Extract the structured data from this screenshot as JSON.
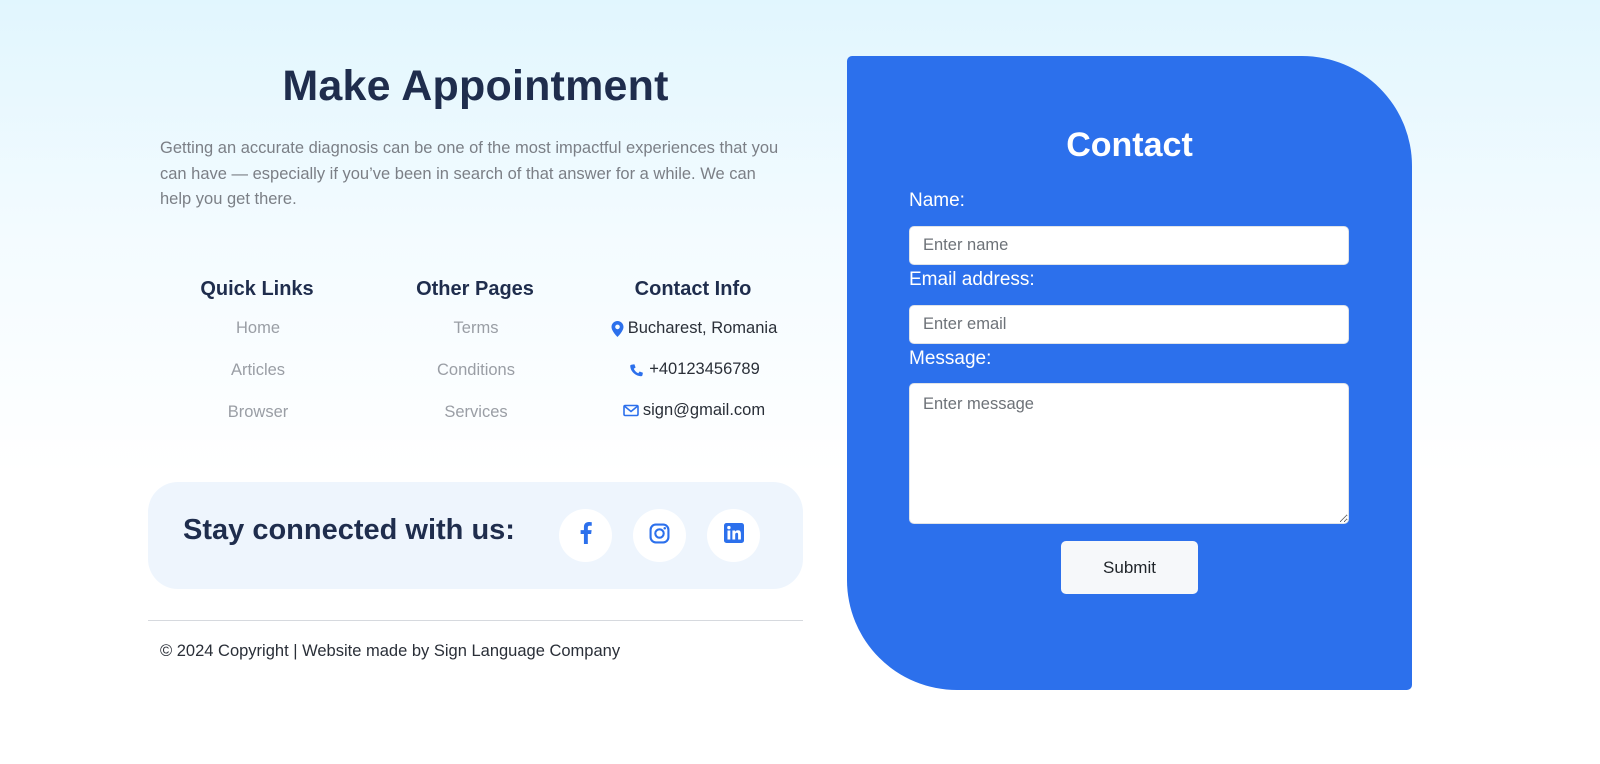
{
  "appointment": {
    "title": "Make Appointment",
    "description": "Getting an accurate diagnosis can be one of the most impactful experiences that you can have — especially if you’ve been in search of that answer for a while. We can help you get there."
  },
  "quick_links": {
    "heading": "Quick Links",
    "items": [
      "Home",
      "Articles",
      "Browser"
    ]
  },
  "other_pages": {
    "heading": "Other Pages",
    "items": [
      "Terms",
      "Conditions",
      "Services"
    ]
  },
  "contact_info": {
    "heading": "Contact Info",
    "location": "Bucharest, Romania",
    "phone": "+40123456789",
    "email": "sign@gmail.com",
    "icons": [
      "location-pin-icon",
      "phone-icon",
      "envelope-icon"
    ]
  },
  "social": {
    "label": "Stay connected with us:",
    "icons": [
      "facebook-icon",
      "instagram-icon",
      "linkedin-icon"
    ]
  },
  "footer": {
    "copyright": "© 2024 Copyright | Website made by Sign Language Company"
  },
  "contact_form": {
    "title": "Contact",
    "name_label": "Name:",
    "name_placeholder": "Enter name",
    "email_label": "Email address:",
    "email_placeholder": "Enter email",
    "message_label": "Message:",
    "message_placeholder": "Enter message",
    "submit_label": "Submit"
  },
  "colors": {
    "accent": "#2c70ec",
    "heading": "#1f2d4d",
    "muted_text": "#9a9ea5"
  }
}
